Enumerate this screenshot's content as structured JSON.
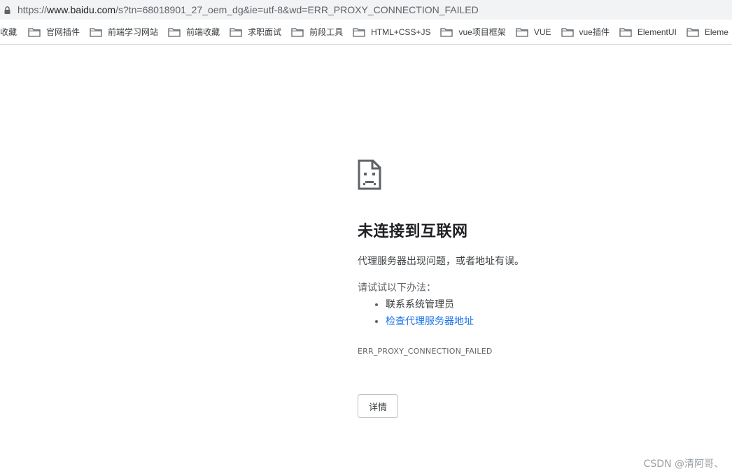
{
  "address_bar": {
    "scheme": "https://",
    "host": "www.baidu.com",
    "path": "/s?tn=68018901_27_oem_dg&ie=utf-8&wd=ERR_PROXY_CONNECTION_FAILED"
  },
  "bookmarks": {
    "first_label": "收藏",
    "folders": [
      "官网插件",
      "前端学习网站",
      "前端收藏",
      "求职面试",
      "前段工具",
      "HTML+CSS+JS",
      "vue项目框架",
      "VUE",
      "vue插件",
      "ElementUI",
      "Eleme"
    ]
  },
  "error_page": {
    "icon": "sad-page-icon",
    "title": "未连接到互联网",
    "description": "代理服务器出现问题，或者地址有误。",
    "suggestions_heading": "请试试以下办法：",
    "suggestions": {
      "item1": "联系系统管理员",
      "item2_link": "检查代理服务器地址"
    },
    "error_code": "ERR_PROXY_CONNECTION_FAILED",
    "details_button": "详情"
  },
  "watermark": "CSDN @清阿哥、",
  "colors": {
    "link": "#1a73e8",
    "title": "#202124",
    "secondary_text": "#5f6368",
    "url_bar_bg": "#f1f3f4"
  }
}
